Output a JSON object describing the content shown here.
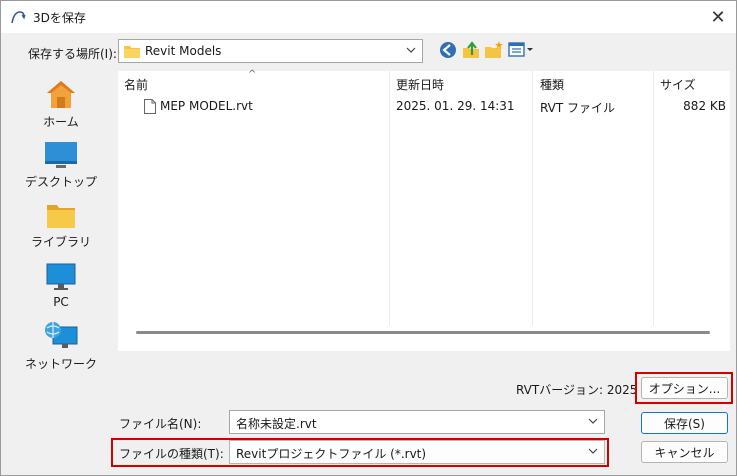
{
  "window": {
    "title": "3Dを保存"
  },
  "location": {
    "label": "保存する場所(I):",
    "value": "Revit Models"
  },
  "toolbar": {
    "icons": [
      "back-icon",
      "up-folder-icon",
      "new-folder-icon",
      "view-menu-icon"
    ]
  },
  "places": [
    {
      "label": "ホーム",
      "icon": "home-icon"
    },
    {
      "label": "デスクトップ",
      "icon": "desktop-icon"
    },
    {
      "label": "ライブラリ",
      "icon": "library-icon"
    },
    {
      "label": "PC",
      "icon": "pc-icon"
    },
    {
      "label": "ネットワーク",
      "icon": "network-icon"
    }
  ],
  "columns": {
    "name": "名前",
    "modified": "更新日時",
    "type": "種類",
    "size": "サイズ"
  },
  "files": [
    {
      "name": "MEP MODEL.rvt",
      "modified": "2025. 01. 29. 14:31",
      "type": "RVT ファイル",
      "size": "882 KB"
    }
  ],
  "version_text": "RVTバージョン: 2025",
  "buttons": {
    "options": "オプション...",
    "save": "保存(S)",
    "cancel": "キャンセル"
  },
  "filename": {
    "label": "ファイル名(N):",
    "value": "名称未設定.rvt"
  },
  "filetype": {
    "label": "ファイルの種類(T):",
    "value": "Revitプロジェクトファイル (*.rvt)"
  },
  "colors": {
    "highlight": "#d40000",
    "default_button_border": "#1a73c8",
    "folder": "#f6c343"
  }
}
